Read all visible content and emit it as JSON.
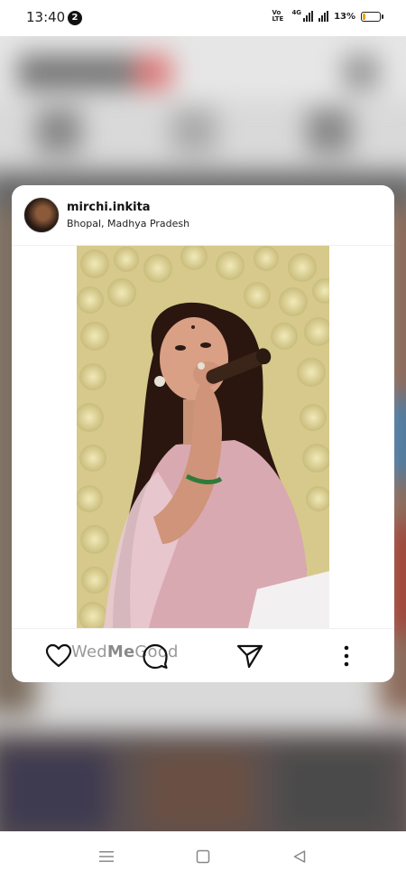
{
  "status_bar": {
    "time": "13:40",
    "notification_count": "2",
    "volte_label": "Vo LTE",
    "network_label": "4G",
    "battery_percent": "13%"
  },
  "post": {
    "username": "mirchi.inkita",
    "location": "Bhopal, Madhya Pradesh",
    "watermark_prefix": "Wed",
    "watermark_middle": "Me",
    "watermark_suffix": "Good"
  },
  "icons": {
    "like": "heart-icon",
    "comment": "comment-icon",
    "share": "send-icon",
    "more": "more-vertical-icon"
  },
  "colors": {
    "card_background": "#ffffff",
    "battery_fill": "#f0a500"
  }
}
